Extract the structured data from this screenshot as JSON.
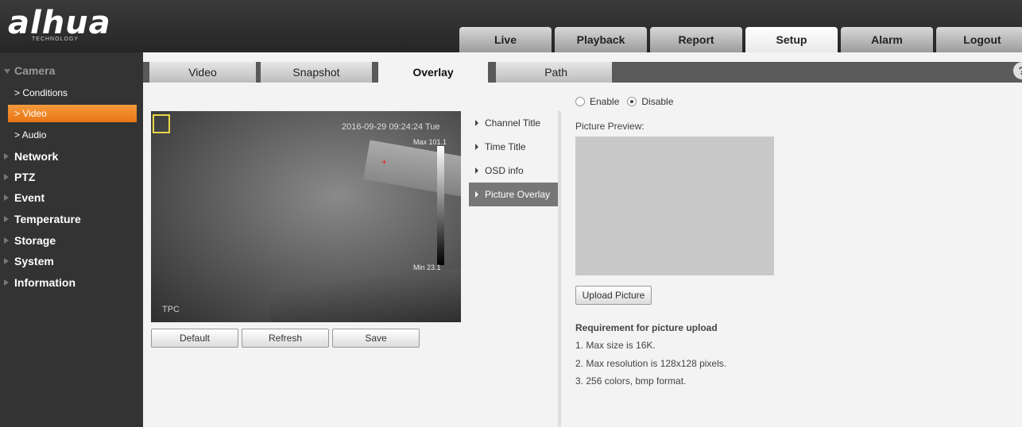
{
  "header": {
    "logo": "alhua",
    "logo_sub": "TECHNOLOGY",
    "tabs": [
      "Live",
      "Playback",
      "Report",
      "Setup",
      "Alarm",
      "Logout"
    ],
    "active_tab": "Setup"
  },
  "sidebar": {
    "camera": "Camera",
    "sub_items": [
      "> Conditions",
      "> Video",
      "> Audio"
    ],
    "active_sub": "> Video",
    "items": [
      "Network",
      "PTZ",
      "Event",
      "Temperature",
      "Storage",
      "System",
      "Information"
    ]
  },
  "subtabs": [
    "Video",
    "Snapshot",
    "Overlay",
    "Path"
  ],
  "active_subtab": "Overlay",
  "help_icon": "?",
  "video": {
    "timestamp": "2016-09-29 09:24:24 Tue",
    "max_label": "Max 101.1",
    "min_label": "Min 23.1",
    "channel_label": "TPC"
  },
  "buttons": {
    "default": "Default",
    "refresh": "Refresh",
    "save": "Save"
  },
  "osd_menu": [
    "Channel Title",
    "Time Title",
    "OSD info",
    "Picture Overlay"
  ],
  "active_osd": "Picture Overlay",
  "form": {
    "enable": "Enable",
    "disable": "Disable",
    "selected": "Disable",
    "preview_label": "Picture Preview:",
    "upload_button": "Upload Picture",
    "requirement_title": "Requirement for picture upload",
    "requirements": [
      "1. Max size is 16K.",
      "2. Max resolution is 128x128 pixels.",
      "3. 256 colors, bmp format."
    ]
  }
}
